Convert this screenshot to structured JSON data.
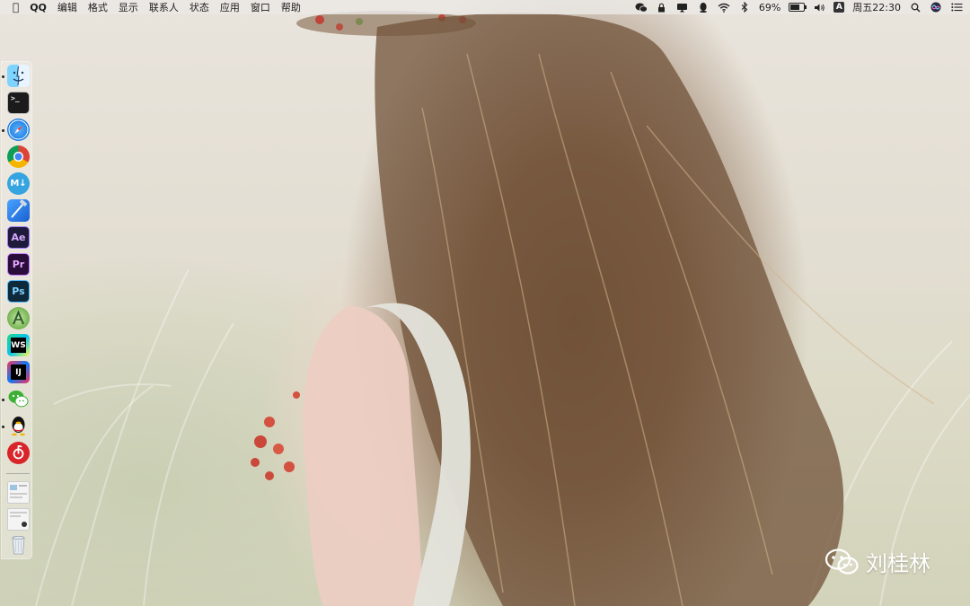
{
  "menubar": {
    "apple_icon": "apple-logo-icon",
    "menus": [
      "QQ",
      "编辑",
      "格式",
      "显示",
      "联系人",
      "状态",
      "应用",
      "窗口",
      "帮助"
    ],
    "tray": {
      "battery_percent": "69%",
      "battery_level": 0.69,
      "input_source": "A",
      "datetime": "周五22:30"
    }
  },
  "dock": {
    "items": [
      {
        "name": "finder",
        "icon": "finder-icon",
        "running": true
      },
      {
        "name": "terminal",
        "icon": "terminal-icon",
        "label": ">_",
        "running": false
      },
      {
        "name": "safari",
        "icon": "safari-compass-icon",
        "running": true
      },
      {
        "name": "chrome",
        "icon": "chrome-icon",
        "running": false
      },
      {
        "name": "markdown",
        "icon": "markdown-m-icon",
        "label": "M↓",
        "running": false
      },
      {
        "name": "xcode",
        "icon": "xcode-hammer-icon",
        "running": false
      },
      {
        "name": "after-effects",
        "icon": "after-effects-icon",
        "label": "Ae",
        "running": false
      },
      {
        "name": "premiere",
        "icon": "premiere-icon",
        "label": "Pr",
        "running": false
      },
      {
        "name": "photoshop",
        "icon": "photoshop-icon",
        "label": "Ps",
        "running": false
      },
      {
        "name": "android-studio",
        "icon": "android-studio-icon",
        "running": false
      },
      {
        "name": "webstorm",
        "icon": "webstorm-icon",
        "label": "WS",
        "running": false
      },
      {
        "name": "intellij",
        "icon": "intellij-icon",
        "label": "IJ",
        "running": false
      },
      {
        "name": "wechat",
        "icon": "wechat-icon",
        "running": true
      },
      {
        "name": "qq",
        "icon": "qq-penguin-icon",
        "running": true
      },
      {
        "name": "netease-music",
        "icon": "netease-music-icon",
        "running": false
      }
    ],
    "recent": [
      {
        "name": "recent-document-1",
        "icon": "document-thumbnail-icon"
      },
      {
        "name": "recent-document-2",
        "icon": "document-thumbnail-icon"
      }
    ],
    "trash_icon": "trash-icon"
  },
  "watermark": {
    "icon": "wechat-icon",
    "text": "刘桂林"
  },
  "colors": {
    "menubar_bg": "#ECE9E5",
    "photoshop_bg": "#0E2A3A",
    "after_effects_bg": "#1E1B3A",
    "premiere_bg": "#2A0E3A",
    "netease_red": "#D9252A",
    "wechat_green": "#3CB034"
  }
}
